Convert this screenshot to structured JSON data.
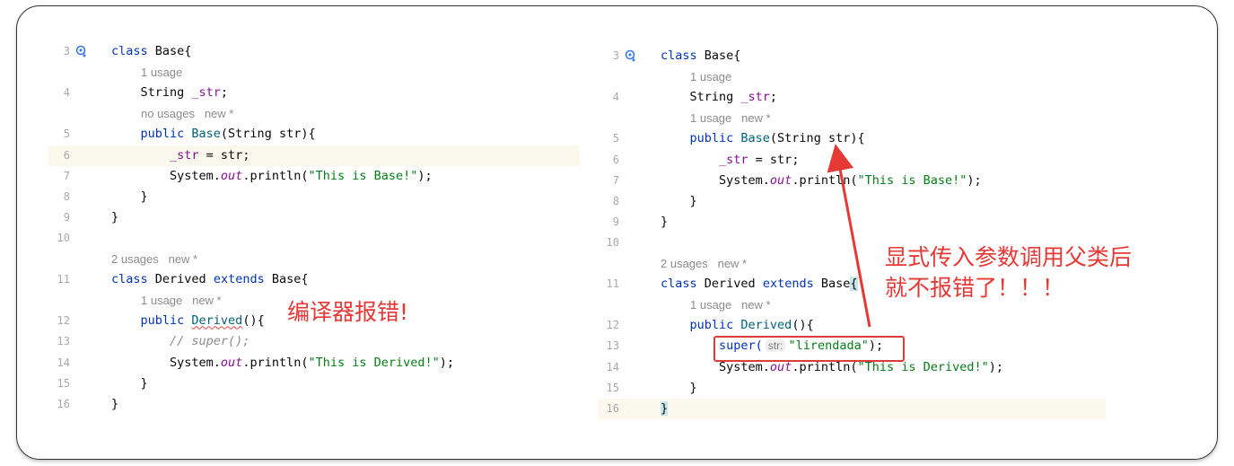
{
  "left_panel": {
    "lines": [
      {
        "num": "3",
        "kind": "code",
        "icon": "override-icon",
        "segments": [
          {
            "t": "class ",
            "c": "kw"
          },
          {
            "t": "Base{",
            "c": ""
          }
        ]
      },
      {
        "num": "",
        "kind": "hint",
        "indent": 1,
        "text": "1 usage"
      },
      {
        "num": "4",
        "kind": "code",
        "segments": [
          {
            "t": "    String ",
            "c": ""
          },
          {
            "t": "_str",
            "c": "fld"
          },
          {
            "t": ";",
            "c": ""
          }
        ]
      },
      {
        "num": "",
        "kind": "hint",
        "indent": 1,
        "text": "no usages   new *"
      },
      {
        "num": "5",
        "kind": "code",
        "segments": [
          {
            "t": "    public ",
            "c": "kw"
          },
          {
            "t": "Base",
            "c": "mt"
          },
          {
            "t": "(String str){",
            "c": ""
          }
        ]
      },
      {
        "num": "6",
        "kind": "code",
        "hl": true,
        "segments": [
          {
            "t": "        _str",
            "c": "fld"
          },
          {
            "t": " = str;",
            "c": ""
          }
        ]
      },
      {
        "num": "7",
        "kind": "code",
        "segments": [
          {
            "t": "        System.",
            "c": ""
          },
          {
            "t": "out",
            "c": "out"
          },
          {
            "t": ".println(",
            "c": ""
          },
          {
            "t": "\"This is Base!\"",
            "c": "str"
          },
          {
            "t": ");",
            "c": ""
          }
        ]
      },
      {
        "num": "8",
        "kind": "code",
        "segments": [
          {
            "t": "    }",
            "c": ""
          }
        ]
      },
      {
        "num": "9",
        "kind": "code",
        "segments": [
          {
            "t": "}",
            "c": ""
          }
        ]
      },
      {
        "num": "10",
        "kind": "code",
        "segments": []
      },
      {
        "num": "",
        "kind": "hint",
        "indent": 0,
        "text": "2 usages   new *"
      },
      {
        "num": "11",
        "kind": "code",
        "segments": [
          {
            "t": "class ",
            "c": "kw"
          },
          {
            "t": "Derived ",
            "c": ""
          },
          {
            "t": "extends ",
            "c": "kw"
          },
          {
            "t": "Base{",
            "c": ""
          }
        ]
      },
      {
        "num": "",
        "kind": "hint",
        "indent": 1,
        "text": "1 usage   new *"
      },
      {
        "num": "12",
        "kind": "code",
        "segments": [
          {
            "t": "    public ",
            "c": "kw"
          },
          {
            "t": "Derived",
            "c": "mt err"
          },
          {
            "t": "(){",
            "c": ""
          }
        ]
      },
      {
        "num": "13",
        "kind": "code",
        "segments": [
          {
            "t": "        // super();",
            "c": "cmt"
          }
        ]
      },
      {
        "num": "14",
        "kind": "code",
        "segments": [
          {
            "t": "        System.",
            "c": ""
          },
          {
            "t": "out",
            "c": "out"
          },
          {
            "t": ".println(",
            "c": ""
          },
          {
            "t": "\"This is Derived!\"",
            "c": "str"
          },
          {
            "t": ");",
            "c": ""
          }
        ]
      },
      {
        "num": "15",
        "kind": "code",
        "segments": [
          {
            "t": "    }",
            "c": ""
          }
        ]
      },
      {
        "num": "16",
        "kind": "code",
        "segments": [
          {
            "t": "}",
            "c": ""
          }
        ]
      }
    ],
    "annotation": "编译器报错!"
  },
  "right_panel": {
    "lines": [
      {
        "num": "3",
        "kind": "code",
        "icon": "override-icon",
        "segments": [
          {
            "t": "class ",
            "c": "kw"
          },
          {
            "t": "Base{",
            "c": ""
          }
        ]
      },
      {
        "num": "",
        "kind": "hint",
        "indent": 1,
        "text": "1 usage"
      },
      {
        "num": "4",
        "kind": "code",
        "segments": [
          {
            "t": "    String ",
            "c": ""
          },
          {
            "t": "_str",
            "c": "fld"
          },
          {
            "t": ";",
            "c": ""
          }
        ]
      },
      {
        "num": "",
        "kind": "hint",
        "indent": 1,
        "text": "1 usage   new *"
      },
      {
        "num": "5",
        "kind": "code",
        "segments": [
          {
            "t": "    public ",
            "c": "kw"
          },
          {
            "t": "Base",
            "c": "mt"
          },
          {
            "t": "(String str){",
            "c": ""
          }
        ]
      },
      {
        "num": "6",
        "kind": "code",
        "segments": [
          {
            "t": "        _str",
            "c": "fld"
          },
          {
            "t": " = str;",
            "c": ""
          }
        ]
      },
      {
        "num": "7",
        "kind": "code",
        "segments": [
          {
            "t": "        System.",
            "c": ""
          },
          {
            "t": "out",
            "c": "out"
          },
          {
            "t": ".println(",
            "c": ""
          },
          {
            "t": "\"This is Base!\"",
            "c": "str"
          },
          {
            "t": ");",
            "c": ""
          }
        ]
      },
      {
        "num": "8",
        "kind": "code",
        "segments": [
          {
            "t": "    }",
            "c": ""
          }
        ]
      },
      {
        "num": "9",
        "kind": "code",
        "segments": [
          {
            "t": "}",
            "c": ""
          }
        ]
      },
      {
        "num": "10",
        "kind": "code",
        "segments": []
      },
      {
        "num": "",
        "kind": "hint",
        "indent": 0,
        "text": "2 usages   new *"
      },
      {
        "num": "11",
        "kind": "code",
        "segments": [
          {
            "t": "class ",
            "c": "kw"
          },
          {
            "t": "Derived ",
            "c": ""
          },
          {
            "t": "extends ",
            "c": "kw"
          },
          {
            "t": "Base",
            "c": ""
          },
          {
            "t": "{",
            "c": "caret-mark"
          }
        ]
      },
      {
        "num": "",
        "kind": "hint",
        "indent": 1,
        "text": "1 usage   new *"
      },
      {
        "num": "12",
        "kind": "code",
        "segments": [
          {
            "t": "    public ",
            "c": "kw"
          },
          {
            "t": "Derived",
            "c": "mt"
          },
          {
            "t": "(){",
            "c": ""
          }
        ]
      },
      {
        "num": "13",
        "kind": "super",
        "kw": "super(",
        "param": "str:",
        "arg": "\"lirendada\"",
        "tail": ");"
      },
      {
        "num": "14",
        "kind": "code",
        "segments": [
          {
            "t": "        System.",
            "c": ""
          },
          {
            "t": "out",
            "c": "out"
          },
          {
            "t": ".println(",
            "c": ""
          },
          {
            "t": "\"This is Derived!\"",
            "c": "str"
          },
          {
            "t": ");",
            "c": ""
          }
        ]
      },
      {
        "num": "15",
        "kind": "code",
        "segments": [
          {
            "t": "    }",
            "c": ""
          }
        ]
      },
      {
        "num": "16",
        "kind": "code",
        "hl": true,
        "segments": [
          {
            "t": "}",
            "c": "caret-mark"
          }
        ]
      }
    ],
    "annotation": "显式传入参数调用父类后\n就不报错了！！！"
  },
  "colors": {
    "annotation": "#e53935",
    "keyword": "#0033b3",
    "string": "#067d17",
    "field": "#871094"
  }
}
